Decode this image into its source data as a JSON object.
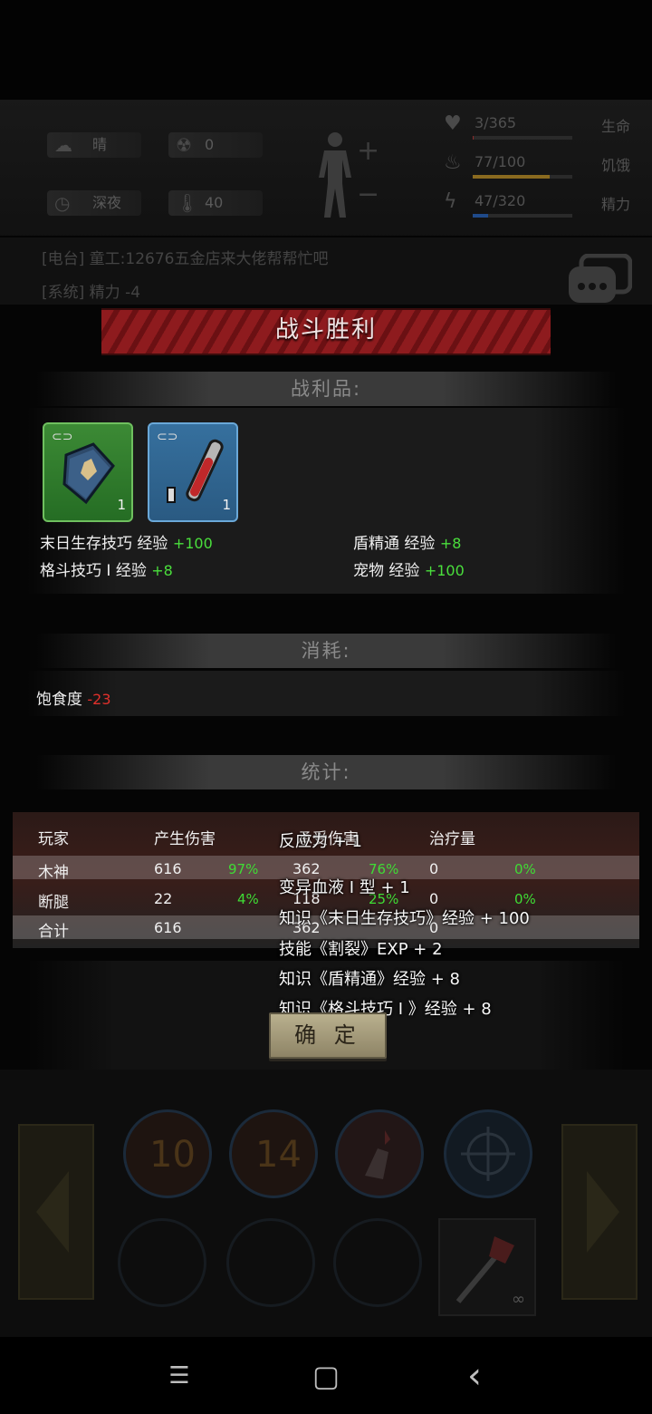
{
  "status": {
    "weather": {
      "icon": "cloud-sun-icon",
      "label": "晴"
    },
    "radiation": {
      "icon": "radiation-icon",
      "value": "0"
    },
    "time": {
      "icon": "clock-icon",
      "label": "深夜"
    },
    "temperature": {
      "icon": "thermometer-icon",
      "value": "40"
    },
    "stats": [
      {
        "icon": "heart-icon",
        "value": "3/365",
        "label": "生命",
        "fill": 0.01,
        "color": "#8a2b2b"
      },
      {
        "icon": "stomach-icon",
        "value": "77/100",
        "label": "饥饿",
        "fill": 0.77,
        "color": "#8a6a1f"
      },
      {
        "icon": "energy-icon",
        "value": "47/320",
        "label": "精力",
        "fill": 0.15,
        "color": "#1f4a8a"
      }
    ],
    "add_symbol": "+",
    "minus_symbol": "−"
  },
  "chat": {
    "lines": [
      "[电台] 童工:12676五金店来大佬帮帮忙吧",
      "[系统] 精力 -4"
    ]
  },
  "battle": {
    "title": "战斗胜利",
    "loot_header": "战利品:",
    "items": [
      {
        "name": "book-item",
        "count": "1",
        "color": "#2f7d2d"
      },
      {
        "name": "test-tube-item",
        "count": "1",
        "color": "#2c5f8c"
      }
    ],
    "exp_left": [
      {
        "label": "末日生存技巧 经验",
        "value": "+100"
      },
      {
        "label": "格斗技巧 I  经验",
        "value": "+8"
      }
    ],
    "exp_right": [
      {
        "label": "盾精通 经验",
        "value": "+8"
      },
      {
        "label": "宠物 经验",
        "value": "+100"
      }
    ],
    "consume_header": "消耗:",
    "consume": [
      {
        "label": "饱食度",
        "value": "-23"
      }
    ],
    "stats_header": "统计:",
    "table": {
      "columns": [
        "玩家",
        "产生伤害",
        "承受伤害",
        "治疗量"
      ],
      "rows": [
        {
          "name": "木神",
          "dealt": "616",
          "dealt_pct": "97%",
          "taken": "362",
          "taken_pct": "76%",
          "heal": "0",
          "heal_pct": "0%"
        },
        {
          "name": "断腿",
          "dealt": "22",
          "dealt_pct": "4%",
          "taken": "118",
          "taken_pct": "25%",
          "heal": "0",
          "heal_pct": "0%"
        },
        {
          "name": "合计",
          "dealt": "616",
          "dealt_pct": "",
          "taken": "362",
          "taken_pct": "",
          "heal": "0",
          "heal_pct": ""
        }
      ]
    },
    "float_messages": [
      "反应力 + 1",
      "变异血液 I 型 + 1",
      "知识《末日生存技巧》经验 + 100",
      "技能《割裂》EXP + 2",
      "知识《盾精通》经验 + 8",
      "知识《格斗技巧 I 》经验 + 8"
    ],
    "confirm_label": "确 定"
  },
  "skills": {
    "cooldowns": [
      "10",
      "14"
    ],
    "infinity": "∞"
  },
  "navbar": {
    "menu": "☰",
    "home": "▢",
    "back": "‹"
  }
}
